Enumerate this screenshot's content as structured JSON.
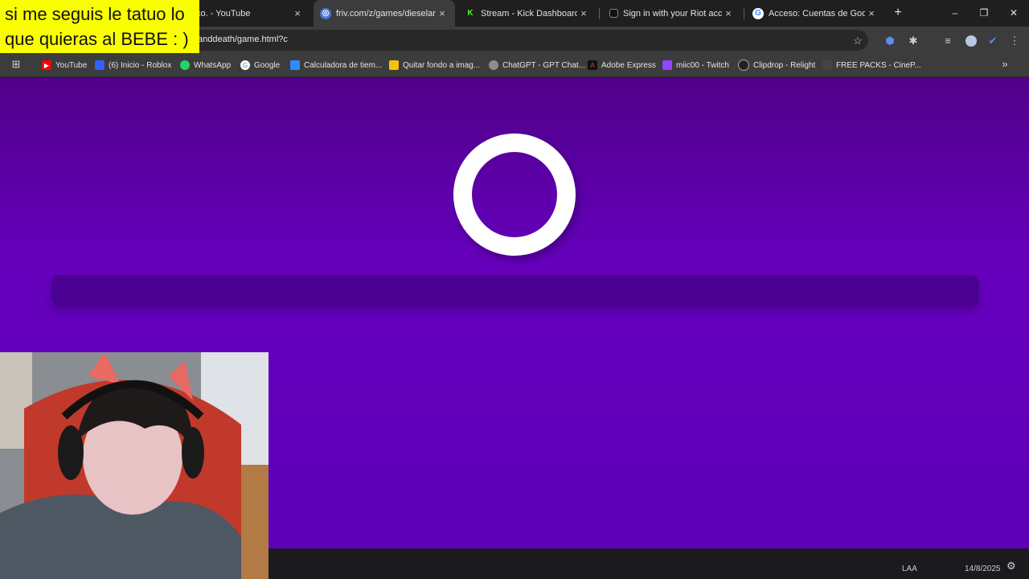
{
  "overlay": {
    "line1": "si me seguis le tatuo lo",
    "line2": "que quieras al BEBE : )"
  },
  "tabs": [
    {
      "title": "co. - YouTube",
      "close": "×"
    },
    {
      "title": "friv.com/z/games/dieseland",
      "close": "×",
      "active": true
    },
    {
      "title": "Stream - Kick Dashboard",
      "close": "×",
      "fav": "K"
    },
    {
      "title": "Sign in with your Riot accou",
      "close": "×"
    },
    {
      "title": "Acceso: Cuentas de Google",
      "close": "×",
      "fav": "G"
    }
  ],
  "new_tab": "+",
  "window_controls": {
    "minimize": "–",
    "maximize": "❐",
    "close": "✕"
  },
  "address": {
    "url": "anddeath/game.html?c"
  },
  "bookmarks": [
    {
      "label": "YouTube",
      "color": "#ff0000"
    },
    {
      "label": "(6) Inicio - Roblox",
      "color": "#335fff"
    },
    {
      "label": "WhatsApp",
      "color": "#25d366"
    },
    {
      "label": "Google",
      "color": "#4285f4"
    },
    {
      "label": "Calculadora de tiem...",
      "color": "#2d8cff"
    },
    {
      "label": "Quitar fondo a imag...",
      "color": "#f4c20d"
    },
    {
      "label": "ChatGPT - GPT Chat...",
      "color": "#8e8e8e"
    },
    {
      "label": "Adobe Express",
      "color": "#111111"
    },
    {
      "label": "miic00 - Twitch",
      "color": "#9146ff"
    },
    {
      "label": "Clipdrop - Relight",
      "color": "#222222"
    },
    {
      "label": "FREE PACKS - CineP...",
      "color": "#444444"
    }
  ],
  "bookmarks_more": "»",
  "game": {
    "loading_progress": 0.0,
    "theme_color": "#6000b8"
  },
  "taskbar": {
    "lang": "LAA",
    "date": "14/8/2025"
  }
}
